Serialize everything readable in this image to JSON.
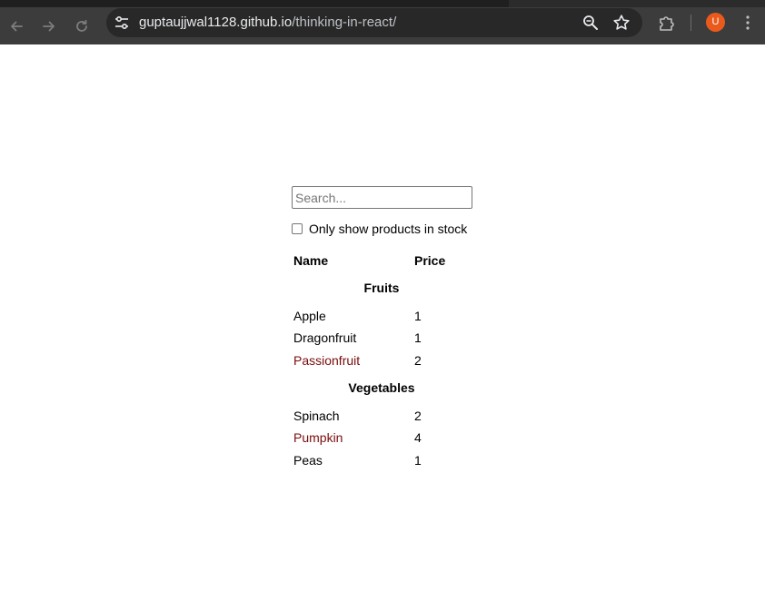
{
  "browser": {
    "url_host": "guptaujjwal1128.github.io",
    "url_path": "/thinking-in-react/",
    "avatar_letter": "U",
    "icons": [
      "back-arrow-icon",
      "forward-arrow-icon",
      "reload-icon",
      "site-settings-icon",
      "zoom-icon",
      "bookmark-star-icon",
      "extensions-icon",
      "more-menu-icon"
    ]
  },
  "search": {
    "placeholder": "Search...",
    "value": ""
  },
  "stock_filter": {
    "label": "Only show products in stock",
    "checked": false
  },
  "table": {
    "headers": {
      "name": "Name",
      "price": "Price"
    },
    "categories": [
      {
        "name": "Fruits",
        "rows": [
          {
            "name": "Apple",
            "price": "1",
            "in_stock": true
          },
          {
            "name": "Dragonfruit",
            "price": "1",
            "in_stock": true
          },
          {
            "name": "Passionfruit",
            "price": "2",
            "in_stock": false
          }
        ]
      },
      {
        "name": "Vegetables",
        "rows": [
          {
            "name": "Spinach",
            "price": "2",
            "in_stock": true
          },
          {
            "name": "Pumpkin",
            "price": "4",
            "in_stock": false
          },
          {
            "name": "Peas",
            "price": "1",
            "in_stock": true
          }
        ]
      }
    ]
  },
  "colors": {
    "out_of_stock": "#7a0c0c",
    "toolbar": "#3c3c3c",
    "omnibox": "#282828",
    "avatar": "#ea5a1c"
  }
}
